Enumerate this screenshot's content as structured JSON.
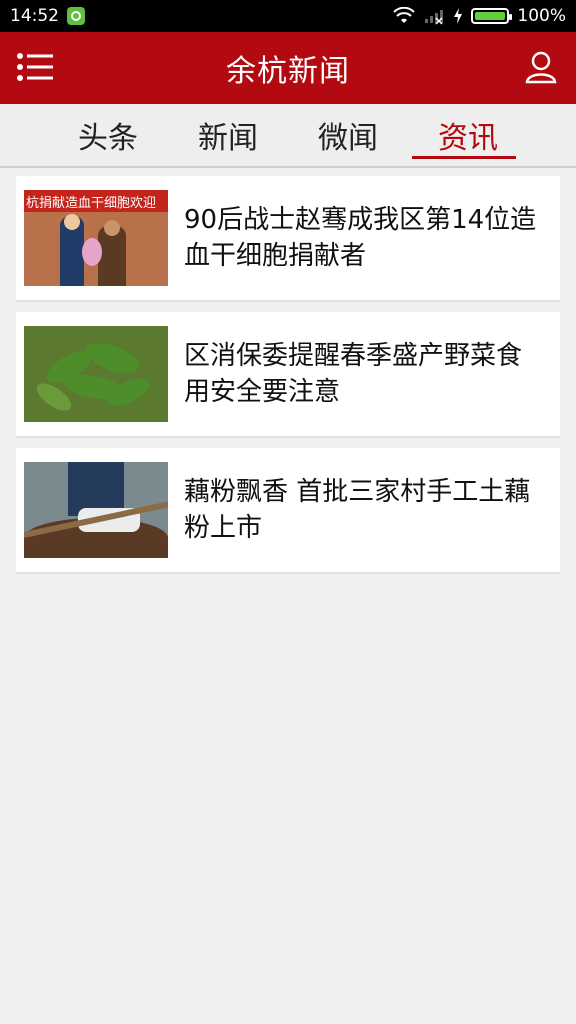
{
  "status_bar": {
    "time": "14:52",
    "battery": "100%"
  },
  "app": {
    "title": "余杭新闻"
  },
  "tabs": [
    {
      "label": "头条",
      "active": false
    },
    {
      "label": "新闻",
      "active": false
    },
    {
      "label": "微闻",
      "active": false
    },
    {
      "label": "资讯",
      "active": true
    }
  ],
  "news": [
    {
      "title": "90后战士赵骞成我区第14位造血干细胞捐献者",
      "thumb_banner": "杭捐献造血干细胞欢迎"
    },
    {
      "title": "区消保委提醒春季盛产野菜食用安全要注意"
    },
    {
      "title": "藕粉飘香 首批三家村手工土藕粉上市"
    }
  ],
  "colors": {
    "brand": "#b20a10",
    "background": "#f0f0f0"
  }
}
